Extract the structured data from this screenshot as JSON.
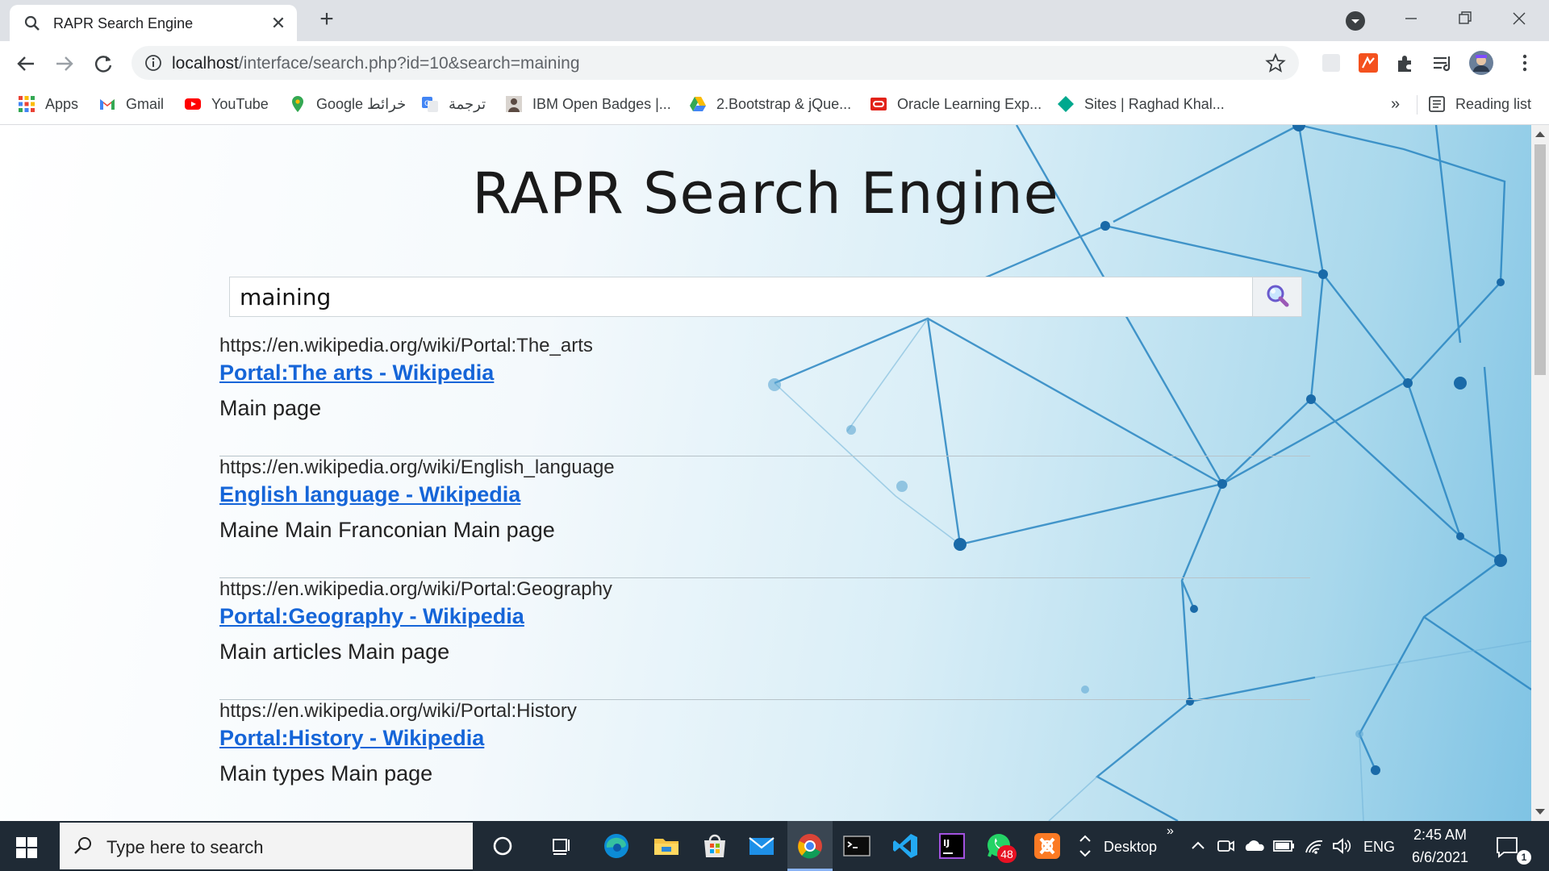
{
  "browser": {
    "tab_title": "RAPR Search Engine",
    "tab_close": "✕",
    "new_tab": "+",
    "address_host": "localhost",
    "address_path": "/interface/search.php?id=10&search=maining"
  },
  "bookmarks": {
    "items": [
      {
        "label": "Apps",
        "icon": "apps-grid-icon"
      },
      {
        "label": "Gmail",
        "icon": "gmail-icon"
      },
      {
        "label": "YouTube",
        "icon": "youtube-icon"
      },
      {
        "label": "Google خرائط",
        "icon": "google-maps-icon"
      },
      {
        "label": "ترجمة",
        "icon": "google-translate-icon"
      },
      {
        "label": "IBM Open Badges |...",
        "icon": "ibm-badges-icon"
      },
      {
        "label": "2.Bootstrap & jQue...",
        "icon": "google-drive-icon"
      },
      {
        "label": "Oracle Learning Exp...",
        "icon": "oracle-icon"
      },
      {
        "label": "Sites | Raghad Khal...",
        "icon": "google-sites-icon"
      }
    ],
    "more": "»",
    "reading_list": "Reading list"
  },
  "page": {
    "title": "RAPR Search Engine",
    "search_value": "maining",
    "results": [
      {
        "url": "https://en.wikipedia.org/wiki/Portal:The_arts",
        "title": "Portal:The arts - Wikipedia",
        "snippet": "Main page"
      },
      {
        "url": "https://en.wikipedia.org/wiki/English_language",
        "title": "English language - Wikipedia",
        "snippet": "Maine Main Franconian Main page"
      },
      {
        "url": "https://en.wikipedia.org/wiki/Portal:Geography",
        "title": "Portal:Geography - Wikipedia",
        "snippet": "Main articles Main page"
      },
      {
        "url": "https://en.wikipedia.org/wiki/Portal:History",
        "title": "Portal:History - Wikipedia",
        "snippet": "Main types Main page"
      }
    ]
  },
  "taskbar": {
    "search_placeholder": "Type here to search",
    "desktop_label": "Desktop",
    "language": "ENG",
    "time": "2:45 AM",
    "date": "6/6/2021",
    "whatsapp_badge": "48",
    "notification_count": "1",
    "overflow": "»"
  },
  "colors": {
    "link": "#1565d8",
    "taskbar": "#1f2a35",
    "accent": "#8ab4f8"
  }
}
